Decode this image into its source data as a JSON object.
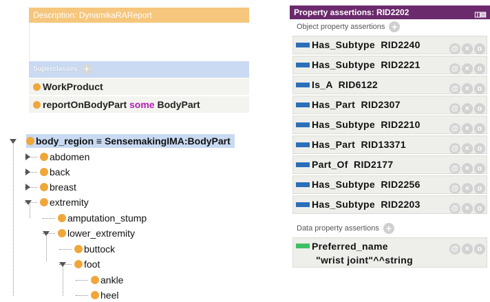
{
  "description_panel": {
    "header": "Description: DynamikaRAReport",
    "superclasses_label": "Superclasses",
    "superclasses": [
      {
        "parts": [
          {
            "text": "WorkProduct",
            "style": "plain"
          }
        ]
      },
      {
        "parts": [
          {
            "text": "reportOnBodyPart ",
            "style": "plain"
          },
          {
            "text": "some",
            "style": "keyword"
          },
          {
            "text": " BodyPart",
            "style": "plain"
          }
        ]
      }
    ]
  },
  "class_tree": {
    "root": "body_region ≡ SensemakingIMA:BodyPart",
    "nodes": [
      {
        "label": "abdomen",
        "expander": "collapsed"
      },
      {
        "label": "back",
        "expander": "collapsed"
      },
      {
        "label": "breast",
        "expander": "collapsed"
      },
      {
        "label": "extremity",
        "expander": "expanded"
      },
      {
        "label": "amputation_stump",
        "expander": "none"
      },
      {
        "label": "lower_extremity",
        "expander": "expanded"
      },
      {
        "label": "buttock",
        "expander": "none"
      },
      {
        "label": "foot",
        "expander": "expanded"
      },
      {
        "label": "ankle",
        "expander": "none"
      },
      {
        "label": "heel",
        "expander": "none"
      }
    ]
  },
  "property_panel": {
    "title": "Property assertions: RID2202",
    "object_section_label": "Object property assertions",
    "object_assertions": [
      "Has_Subtype  RID2240",
      "Has_Subtype  RID2221",
      "Is_A  RID6122",
      "Has_Part  RID2307",
      "Has_Subtype  RID2210",
      "Has_Part  RID13371",
      "Part_Of  RID2177",
      "Has_Subtype  RID2256",
      "Has_Subtype  RID2203"
    ],
    "data_section_label": "Data property assertions",
    "data_assertions": [
      {
        "property": "Preferred_name",
        "value": "\"wrist joint\"^^string"
      }
    ],
    "row_controls": {
      "annotate": "@",
      "delete": "×",
      "edit": "o"
    }
  },
  "colors": {
    "description_header": "#f5c67c",
    "superclasses_header": "#c9daf2",
    "property_header": "#6b2a6c",
    "object_property_bar": "#2a6fb8",
    "data_property_bar": "#3fbf63",
    "class_dot": "#f0a73a",
    "keyword": "#b31eb3"
  },
  "icons": {
    "add": "add-circle-icon",
    "class": "class-dot-icon",
    "object_property": "object-property-icon",
    "data_property": "data-property-icon",
    "view_layout": "view-layout-icon"
  }
}
